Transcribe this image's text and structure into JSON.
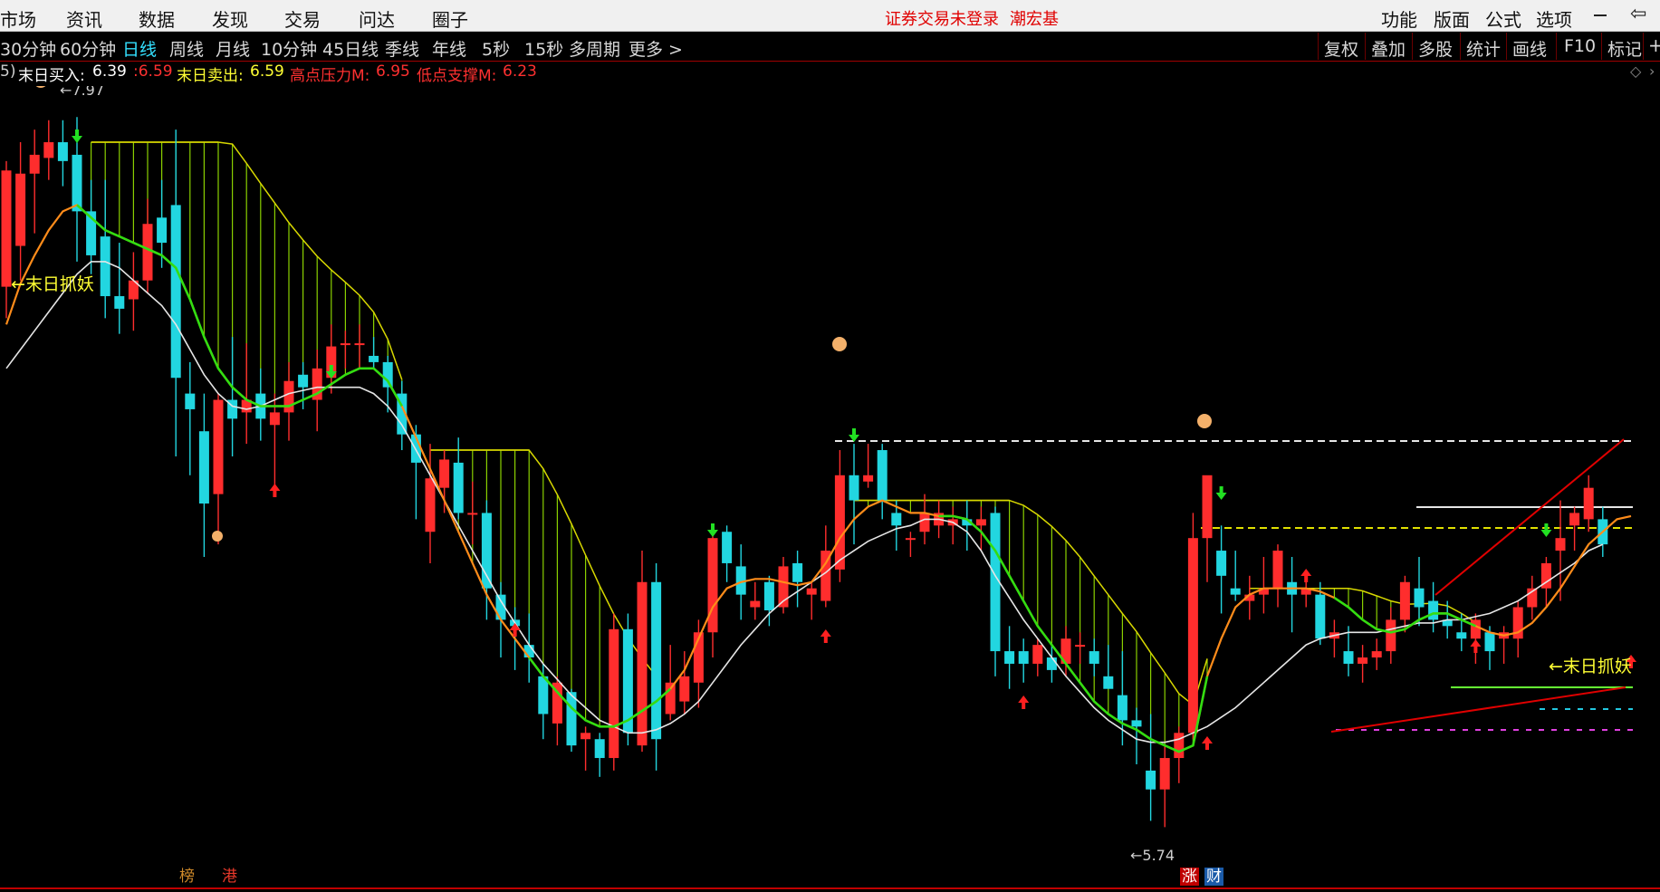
{
  "menu": {
    "left_items": [
      "市场",
      "资讯",
      "数据",
      "发现",
      "交易",
      "问达",
      "圈子"
    ],
    "status": "证券交易未登录",
    "user": "潮宏基",
    "right_items": [
      "功能",
      "版面",
      "公式",
      "选项"
    ]
  },
  "periods": {
    "items": [
      "30分钟",
      "60分钟",
      "日线",
      "周线",
      "月线",
      "10分钟",
      "45日线",
      "季线",
      "年线",
      "5秒",
      "15秒",
      "多周期",
      "更多 >"
    ],
    "active": "日线"
  },
  "tools": [
    "复权",
    "叠加",
    "多股",
    "统计",
    "画线",
    "F10",
    "标记"
  ],
  "indicator": {
    "prefix": "5)",
    "buy_label": "末日买入:",
    "buy_value": "6.39",
    "v2": ":6.59",
    "sell_label": "末日卖出:",
    "sell_value": "6.59",
    "high_label": "高点压力M:",
    "high_value": "6.95",
    "low_label": "低点支撑M:",
    "low_value": "6.23"
  },
  "annotations": {
    "high_marker": "7.97",
    "low_marker": "5.74",
    "catch_label_left": "←末日抓妖",
    "catch_label_right": "←末日抓妖"
  },
  "badges": [
    {
      "text": "榜",
      "color": "#d08a2a"
    },
    {
      "text": "港",
      "color": "#e8392a"
    },
    {
      "text": "涨",
      "color": "#ffffff",
      "bg": "#c00000"
    },
    {
      "text": "财",
      "color": "#ffffff",
      "bg": "#1a5aa8"
    }
  ],
  "colors": {
    "up": "#ff2d2d",
    "down": "#22d6e0",
    "ma_orange": "#ff8c1a",
    "ma_green": "#33dd11",
    "ma_white": "#e6e6e6",
    "band": "#8ad000",
    "band_edge": "#d8d800",
    "accent_red": "#e00000"
  },
  "chart_data": {
    "type": "candlestick",
    "y_range": [
      5.6,
      8.05
    ],
    "candles": [
      [
        7.44,
        7.84,
        7.34,
        7.81
      ],
      [
        7.57,
        7.9,
        7.46,
        7.8
      ],
      [
        7.8,
        7.94,
        7.61,
        7.86
      ],
      [
        7.85,
        7.97,
        7.78,
        7.9
      ],
      [
        7.9,
        7.97,
        7.76,
        7.84
      ],
      [
        7.86,
        7.98,
        7.52,
        7.68
      ],
      [
        7.68,
        7.78,
        7.48,
        7.54
      ],
      [
        7.6,
        7.78,
        7.34,
        7.41
      ],
      [
        7.41,
        7.58,
        7.29,
        7.37
      ],
      [
        7.4,
        7.55,
        7.3,
        7.46
      ],
      [
        7.46,
        7.72,
        7.42,
        7.64
      ],
      [
        7.66,
        7.78,
        7.5,
        7.58
      ],
      [
        7.7,
        7.94,
        6.9,
        7.15
      ],
      [
        7.1,
        7.2,
        6.84,
        7.05
      ],
      [
        6.98,
        7.1,
        6.58,
        6.75
      ],
      [
        6.78,
        7.1,
        6.62,
        7.08
      ],
      [
        7.08,
        7.28,
        6.9,
        7.02
      ],
      [
        7.04,
        7.26,
        6.94,
        7.08
      ],
      [
        7.1,
        7.18,
        6.95,
        7.02
      ],
      [
        7.0,
        7.1,
        6.8,
        7.04
      ],
      [
        7.04,
        7.2,
        6.95,
        7.14
      ],
      [
        7.16,
        7.2,
        7.05,
        7.12
      ],
      [
        7.08,
        7.24,
        6.98,
        7.18
      ],
      [
        7.15,
        7.32,
        7.1,
        7.25
      ],
      [
        7.26,
        7.3,
        7.18,
        7.26
      ],
      [
        7.26,
        7.32,
        7.18,
        7.26
      ],
      [
        7.22,
        7.28,
        7.18,
        7.2
      ],
      [
        7.2,
        7.22,
        7.04,
        7.12
      ],
      [
        7.1,
        7.14,
        6.92,
        6.97
      ],
      [
        6.97,
        7.0,
        6.7,
        6.88
      ],
      [
        6.66,
        6.94,
        6.56,
        6.83
      ],
      [
        6.8,
        6.92,
        6.72,
        6.89
      ],
      [
        6.88,
        6.96,
        6.7,
        6.72
      ],
      [
        6.72,
        6.82,
        6.62,
        6.72
      ],
      [
        6.72,
        6.76,
        6.38,
        6.48
      ],
      [
        6.46,
        6.5,
        6.26,
        6.38
      ],
      [
        6.38,
        6.42,
        6.22,
        6.36
      ],
      [
        6.3,
        6.4,
        6.18,
        6.26
      ],
      [
        6.2,
        6.24,
        6.0,
        6.08
      ],
      [
        6.05,
        6.2,
        5.98,
        6.18
      ],
      [
        6.15,
        6.16,
        5.96,
        5.98
      ],
      [
        6.0,
        6.04,
        5.9,
        6.02
      ],
      [
        6.0,
        6.02,
        5.88,
        5.94
      ],
      [
        5.94,
        6.4,
        5.9,
        6.35
      ],
      [
        6.35,
        6.4,
        5.98,
        6.02
      ],
      [
        5.98,
        6.6,
        5.96,
        6.5
      ],
      [
        6.5,
        6.56,
        5.9,
        6.0
      ],
      [
        6.08,
        6.3,
        6.06,
        6.18
      ],
      [
        6.12,
        6.28,
        6.08,
        6.2
      ],
      [
        6.18,
        6.38,
        6.1,
        6.34
      ],
      [
        6.34,
        6.66,
        6.26,
        6.64
      ],
      [
        6.66,
        6.68,
        6.5,
        6.56
      ],
      [
        6.55,
        6.62,
        6.38,
        6.46
      ],
      [
        6.42,
        6.5,
        6.38,
        6.44
      ],
      [
        6.5,
        6.52,
        6.36,
        6.41
      ],
      [
        6.42,
        6.58,
        6.4,
        6.55
      ],
      [
        6.56,
        6.6,
        6.42,
        6.5
      ],
      [
        6.46,
        6.5,
        6.38,
        6.48
      ],
      [
        6.44,
        6.68,
        6.42,
        6.6
      ],
      [
        6.54,
        6.92,
        6.5,
        6.84
      ],
      [
        6.84,
        6.94,
        6.62,
        6.76
      ],
      [
        6.82,
        6.94,
        6.8,
        6.84
      ],
      [
        6.92,
        6.94,
        6.7,
        6.76
      ],
      [
        6.72,
        6.76,
        6.6,
        6.68
      ],
      [
        6.64,
        6.66,
        6.58,
        6.64
      ],
      [
        6.66,
        6.78,
        6.62,
        6.72
      ],
      [
        6.68,
        6.76,
        6.64,
        6.72
      ],
      [
        6.68,
        6.74,
        6.62,
        6.7
      ],
      [
        6.7,
        6.76,
        6.6,
        6.68
      ],
      [
        6.68,
        6.74,
        6.6,
        6.7
      ],
      [
        6.72,
        6.74,
        6.2,
        6.28
      ],
      [
        6.28,
        6.36,
        6.16,
        6.24
      ],
      [
        6.28,
        6.32,
        6.18,
        6.24
      ],
      [
        6.24,
        6.32,
        6.2,
        6.3
      ],
      [
        6.26,
        6.3,
        6.18,
        6.22
      ],
      [
        6.24,
        6.36,
        6.2,
        6.32
      ],
      [
        6.3,
        6.34,
        6.24,
        6.3
      ],
      [
        6.28,
        6.32,
        6.2,
        6.24
      ],
      [
        6.2,
        6.3,
        6.18,
        6.16
      ],
      [
        6.14,
        6.28,
        5.98,
        6.06
      ],
      [
        6.06,
        6.1,
        5.92,
        6.04
      ],
      [
        5.9,
        6.08,
        5.74,
        5.84
      ],
      [
        5.84,
        5.98,
        5.72,
        5.94
      ],
      [
        5.94,
        6.04,
        5.86,
        6.02
      ],
      [
        6.02,
        6.72,
        6.0,
        6.64
      ],
      [
        6.64,
        6.8,
        6.5,
        6.84
      ],
      [
        6.6,
        6.68,
        6.4,
        6.52
      ],
      [
        6.48,
        6.6,
        6.44,
        6.46
      ],
      [
        6.44,
        6.52,
        6.38,
        6.46
      ],
      [
        6.46,
        6.58,
        6.4,
        6.48
      ],
      [
        6.48,
        6.62,
        6.42,
        6.6
      ],
      [
        6.5,
        6.58,
        6.34,
        6.46
      ],
      [
        6.46,
        6.52,
        6.42,
        6.48
      ],
      [
        6.46,
        6.5,
        6.3,
        6.32
      ],
      [
        6.32,
        6.38,
        6.26,
        6.34
      ],
      [
        6.28,
        6.36,
        6.2,
        6.24
      ],
      [
        6.24,
        6.3,
        6.18,
        6.26
      ],
      [
        6.26,
        6.32,
        6.22,
        6.28
      ],
      [
        6.28,
        6.42,
        6.24,
        6.38
      ],
      [
        6.38,
        6.52,
        6.34,
        6.5
      ],
      [
        6.48,
        6.58,
        6.36,
        6.42
      ],
      [
        6.44,
        6.5,
        6.34,
        6.38
      ],
      [
        6.38,
        6.44,
        6.32,
        6.36
      ],
      [
        6.34,
        6.4,
        6.28,
        6.32
      ],
      [
        6.32,
        6.4,
        6.24,
        6.38
      ],
      [
        6.34,
        6.36,
        6.22,
        6.28
      ],
      [
        6.32,
        6.36,
        6.24,
        6.34
      ],
      [
        6.32,
        6.44,
        6.26,
        6.42
      ],
      [
        6.42,
        6.52,
        6.38,
        6.48
      ],
      [
        6.48,
        6.58,
        6.42,
        6.56
      ],
      [
        6.6,
        6.76,
        6.44,
        6.64
      ],
      [
        6.68,
        6.74,
        6.6,
        6.72
      ],
      [
        6.7,
        6.84,
        6.66,
        6.8
      ],
      [
        6.7,
        6.74,
        6.58,
        6.62
      ]
    ],
    "series": [
      {
        "name": "orange_ma",
        "values": [
          7.32,
          7.45,
          7.54,
          7.62,
          7.68,
          7.7,
          7.66,
          7.62,
          7.6,
          7.58,
          7.56,
          7.54,
          7.5,
          7.4,
          7.28,
          7.18,
          7.12,
          7.08,
          7.06,
          7.06,
          7.06,
          7.08,
          7.1,
          7.13,
          7.16,
          7.18,
          7.18,
          7.14,
          7.06,
          6.96,
          6.86,
          6.76,
          6.66,
          6.56,
          6.46,
          6.38,
          6.32,
          6.26,
          6.2,
          6.15,
          6.1,
          6.06,
          6.04,
          6.04,
          6.06,
          6.09,
          6.12,
          6.16,
          6.22,
          6.32,
          6.42,
          6.48,
          6.5,
          6.51,
          6.51,
          6.5,
          6.49,
          6.5,
          6.56,
          6.64,
          6.7,
          6.74,
          6.76,
          6.74,
          6.72,
          6.72,
          6.71,
          6.71,
          6.7,
          6.66,
          6.6,
          6.52,
          6.44,
          6.36,
          6.3,
          6.24,
          6.18,
          6.12,
          6.08,
          6.05,
          6.03,
          6.0,
          5.98,
          5.96,
          5.98,
          6.2,
          6.32,
          6.42,
          6.46,
          6.48,
          6.48,
          6.48,
          6.48,
          6.47,
          6.45,
          6.42,
          6.38,
          6.35,
          6.34,
          6.35,
          6.38,
          6.4,
          6.4,
          6.38,
          6.36,
          6.34,
          6.33,
          6.34,
          6.37,
          6.42,
          6.48,
          6.55,
          6.62,
          6.66,
          6.7,
          6.71
        ]
      },
      {
        "name": "white_ma",
        "values": [
          7.18,
          7.24,
          7.3,
          7.36,
          7.42,
          7.48,
          7.52,
          7.52,
          7.5,
          7.46,
          7.42,
          7.38,
          7.32,
          7.24,
          7.16,
          7.1,
          7.06,
          7.05,
          7.06,
          7.08,
          7.1,
          7.11,
          7.12,
          7.12,
          7.12,
          7.12,
          7.1,
          7.06,
          7.0,
          6.92,
          6.84,
          6.76,
          6.68,
          6.6,
          6.52,
          6.44,
          6.37,
          6.3,
          6.24,
          6.19,
          6.14,
          6.1,
          6.06,
          6.04,
          6.02,
          6.02,
          6.03,
          6.05,
          6.08,
          6.12,
          6.18,
          6.24,
          6.3,
          6.35,
          6.4,
          6.44,
          6.47,
          6.5,
          6.53,
          6.57,
          6.6,
          6.63,
          6.65,
          6.67,
          6.68,
          6.7,
          6.7,
          6.69,
          6.66,
          6.6,
          6.52,
          6.45,
          6.38,
          6.32,
          6.26,
          6.2,
          6.15,
          6.1,
          6.06,
          6.03,
          6.0,
          5.99,
          5.99,
          6.0,
          6.02,
          6.04,
          6.07,
          6.1,
          6.14,
          6.18,
          6.22,
          6.26,
          6.3,
          6.32,
          6.33,
          6.34,
          6.34,
          6.34,
          6.35,
          6.36,
          6.37,
          6.37,
          6.38,
          6.38,
          6.39,
          6.4,
          6.42,
          6.44,
          6.47,
          6.5,
          6.53,
          6.56,
          6.6,
          6.62
        ]
      }
    ],
    "indicator_values": {
      "buy": 6.39,
      "sell": 6.59,
      "high_pressure": 6.95,
      "low_support": 6.23
    }
  }
}
